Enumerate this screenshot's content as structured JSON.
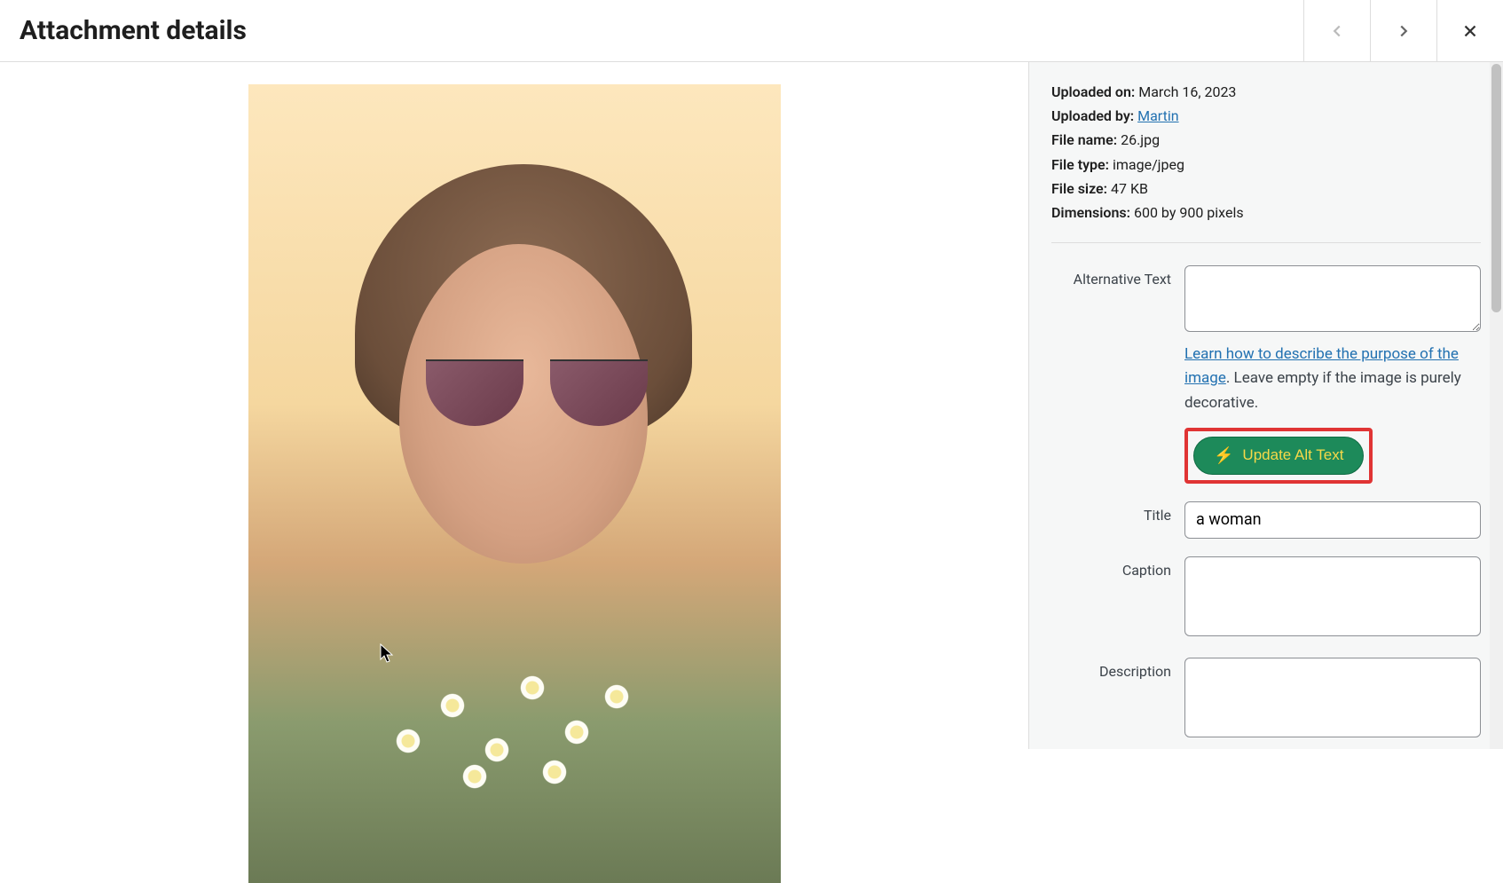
{
  "header": {
    "title": "Attachment details"
  },
  "meta": {
    "uploaded_on_label": "Uploaded on:",
    "uploaded_on_value": "March 16, 2023",
    "uploaded_by_label": "Uploaded by:",
    "uploaded_by_value": "Martin",
    "file_name_label": "File name:",
    "file_name_value": "26.jpg",
    "file_type_label": "File type:",
    "file_type_value": "image/jpeg",
    "file_size_label": "File size:",
    "file_size_value": "47 KB",
    "dimensions_label": "Dimensions:",
    "dimensions_value": "600 by 900 pixels"
  },
  "form": {
    "alt_text_label": "Alternative Text",
    "alt_text_value": "",
    "alt_help_link": "Learn how to describe the purpose of the image",
    "alt_help_rest": ". Leave empty if the image is purely decorative.",
    "update_btn_label": "Update Alt Text",
    "title_label": "Title",
    "title_value": "a woman",
    "caption_label": "Caption",
    "caption_value": "",
    "description_label": "Description",
    "description_value": ""
  }
}
